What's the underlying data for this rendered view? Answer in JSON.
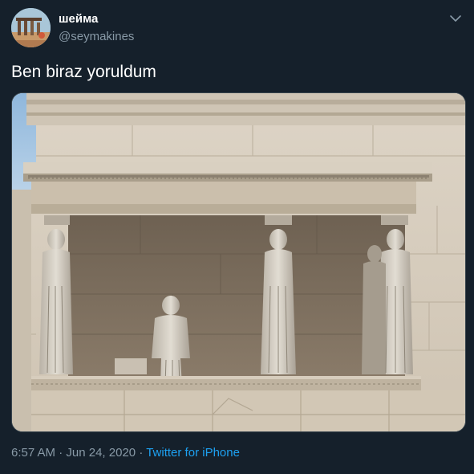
{
  "user": {
    "display_name": "шейма",
    "handle": "@seymakines"
  },
  "menu": {
    "icon": "chevron-down-icon"
  },
  "tweet": {
    "text": "Ben biraz yoruldum",
    "image_description_icon": "photo",
    "time": "6:57 AM",
    "separator": "·",
    "date": "Jun 24, 2020",
    "source": "Twitter for iPhone"
  },
  "colors": {
    "background": "#15202b",
    "secondary_text": "#8899a6",
    "link": "#1da1f2"
  }
}
